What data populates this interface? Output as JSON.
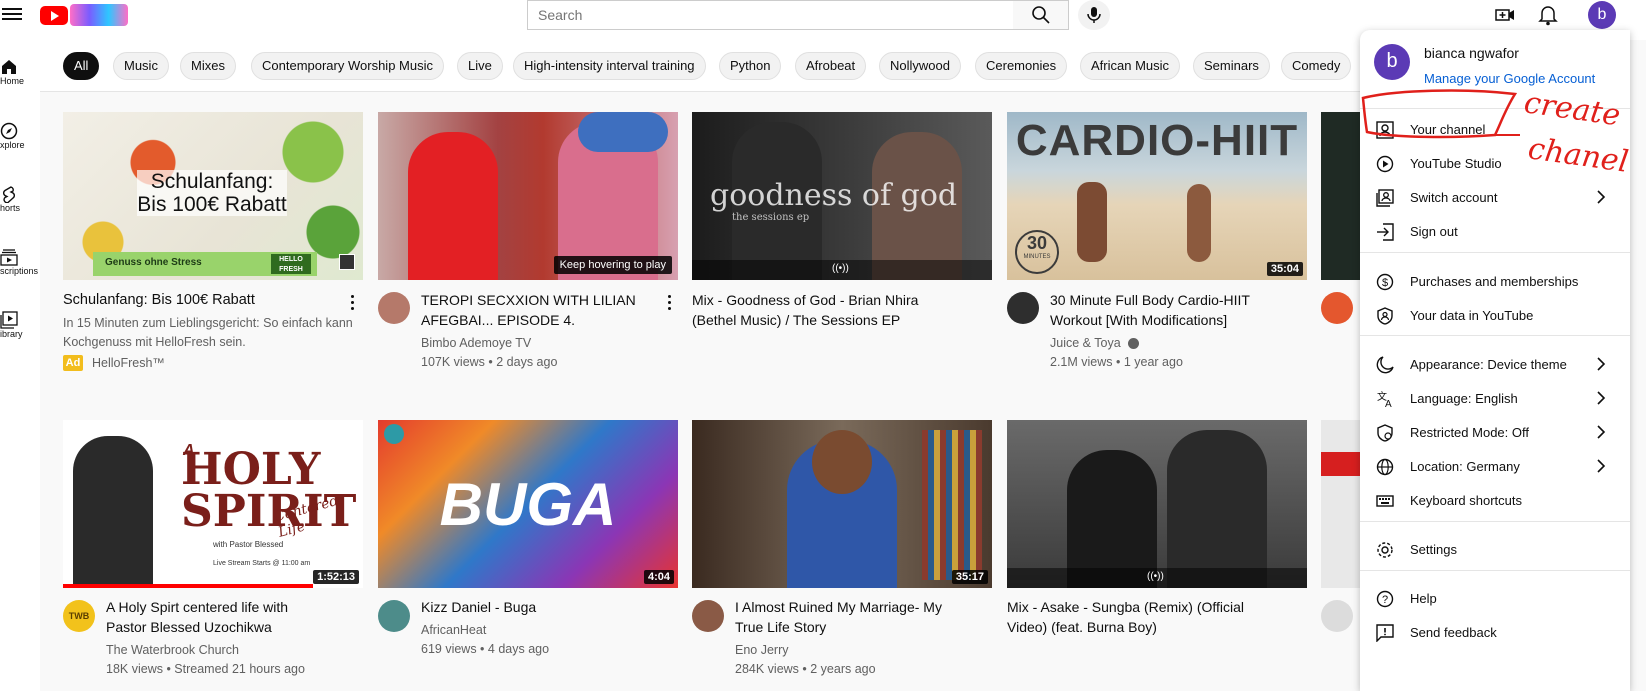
{
  "search": {
    "placeholder": "Search"
  },
  "sidebar": {
    "items": [
      {
        "label": "Home",
        "icon": "home-icon"
      },
      {
        "label": "xplore",
        "icon": "compass-icon"
      },
      {
        "label": "horts",
        "icon": "shorts-icon"
      },
      {
        "label": "scriptions",
        "icon": "subscriptions-icon"
      },
      {
        "label": "ibrary",
        "icon": "library-icon"
      }
    ]
  },
  "chips": [
    "All",
    "Music",
    "Mixes",
    "Contemporary Worship Music",
    "Live",
    "High-intensity interval training",
    "Python",
    "Afrobeat",
    "Nollywood",
    "Ceremonies",
    "African Music",
    "Seminars",
    "Comedy"
  ],
  "videos": [
    {
      "title1": "Schulanfang: Bis 100€ Rabatt",
      "title2": "",
      "line1": "In 15 Minuten zum Lieblingsgericht: So einfach kann",
      "line2": "Kochgenuss mit HelloFresh sein.",
      "ad_badge": "Ad",
      "channel": "HelloFresh™",
      "thumb_text1": "Schulanfang:",
      "thumb_text2": "Bis 100€ Rabatt",
      "thumb_sub": "Genuss ohne Stress",
      "thumb_logo": "HELLO FRESH"
    },
    {
      "title1": "TEROPI SECXXION WITH LILIAN",
      "title2": "AFEGBAI... EPISODE 4.",
      "channel": "Bimbo Ademoye TV",
      "meta": "107K views • 2 days ago",
      "overlay": "Keep hovering to play"
    },
    {
      "title1": "Mix - Goodness of God - Brian Nhira",
      "title2": "(Bethel Music) / The Sessions EP",
      "thumb_text1": "goodness of god",
      "thumb_sub": "the sessions ep"
    },
    {
      "title1": "30 Minute Full Body Cardio-HIIT",
      "title2": "Workout [With Modifications]",
      "channel": "Juice & Toya",
      "meta": "2.1M views • 1 year ago",
      "duration": "35:04",
      "thumb_text1": "CARDIO-HIIT",
      "thumb_badge": "30",
      "thumb_badge_sub": "MINUTES"
    },
    {
      "title1": "A Holy Spirt centered life with",
      "title2": "Pastor Blessed Uzochikwa",
      "channel": "The Waterbrook Church",
      "meta": "18K views • Streamed 21 hours ago",
      "duration": "1:52:13",
      "thumb_text1": "HOLY",
      "thumb_text2": "SPIRIT",
      "thumb_small": "A",
      "thumb_script": "Centered Life",
      "thumb_pastor": "with Pastor Blessed",
      "thumb_live": "Live Stream Starts @ 11:00 am",
      "avatar_text": "TWB"
    },
    {
      "title1": "Kizz Daniel - Buga",
      "title2": "",
      "channel": "AfricanHeat",
      "meta": "619 views • 4 days ago",
      "duration": "4:04",
      "thumb_text1": "BUGA"
    },
    {
      "title1": "I Almost Ruined My Marriage- My",
      "title2": "True Life Story",
      "channel": "Eno Jerry",
      "meta": "284K views • 2 years ago",
      "duration": "35:17"
    },
    {
      "title1": "Mix - Asake - Sungba (Remix) (Official",
      "title2": "Video) (feat. Burna Boy)"
    }
  ],
  "account_menu": {
    "avatar_letter": "b",
    "name": "bianca ngwafor",
    "manage": "Manage your Google Account",
    "items": [
      {
        "label": "Your channel",
        "icon": "person-box-icon",
        "chevron": false
      },
      {
        "label": "YouTube Studio",
        "icon": "studio-icon",
        "chevron": false
      },
      {
        "label": "Switch account",
        "icon": "switch-account-icon",
        "chevron": true
      },
      {
        "label": "Sign out",
        "icon": "sign-out-icon",
        "chevron": false
      },
      {
        "label": "Purchases and memberships",
        "icon": "dollar-icon",
        "chevron": false
      },
      {
        "label": "Your data in YouTube",
        "icon": "shield-person-icon",
        "chevron": false
      },
      {
        "label": "Appearance: Device theme",
        "icon": "moon-icon",
        "chevron": true
      },
      {
        "label": "Language: English",
        "icon": "translate-icon",
        "chevron": true
      },
      {
        "label": "Restricted Mode: Off",
        "icon": "restricted-icon",
        "chevron": true
      },
      {
        "label": "Location: Germany",
        "icon": "globe-icon",
        "chevron": true
      },
      {
        "label": "Keyboard shortcuts",
        "icon": "keyboard-icon",
        "chevron": false
      },
      {
        "label": "Settings",
        "icon": "gear-icon",
        "chevron": false
      },
      {
        "label": "Help",
        "icon": "help-icon",
        "chevron": false
      },
      {
        "label": "Send feedback",
        "icon": "feedback-icon",
        "chevron": false
      }
    ]
  },
  "annotation": {
    "line1": "create",
    "line2": "chanel"
  },
  "avatar_letter_top": "b",
  "colors": {
    "brand_red": "#ff0000",
    "avatar_purple": "#5b3ab5",
    "link_blue": "#065fd4",
    "annotation_red": "#e0201b"
  }
}
